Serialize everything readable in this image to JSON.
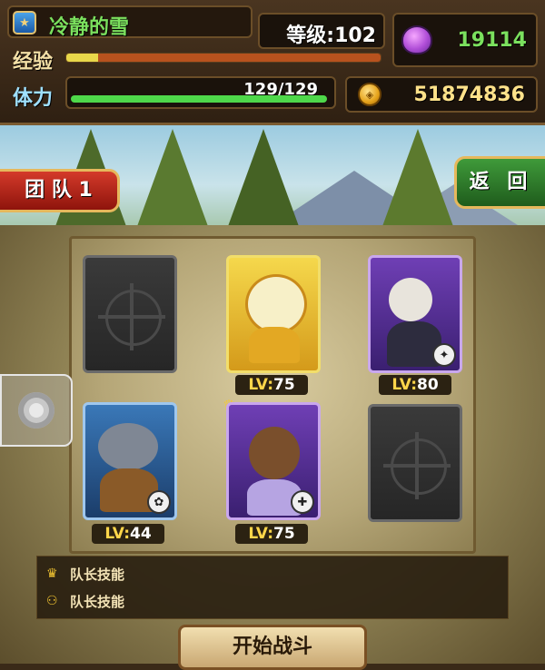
{
  "player": {
    "name": "冷静的雪",
    "level_label": "等级:",
    "level": "102",
    "exp_label": "经验",
    "exp_fraction": 0.1,
    "stamina_label": "体力",
    "stamina_text": "129/129",
    "stamina_fraction": 1.0
  },
  "currency": {
    "gems": "19114",
    "gold": "51874836"
  },
  "buttons": {
    "team": "团 队 1",
    "back": "返 回",
    "start": "开始战斗"
  },
  "slots": [
    {
      "type": "empty"
    },
    {
      "type": "hero",
      "level_prefix": "LV:",
      "level": "75",
      "style": "gold",
      "leader": false
    },
    {
      "type": "hero",
      "level_prefix": "LV:",
      "level": "80",
      "style": "purple",
      "leader": false
    },
    {
      "type": "hero",
      "level_prefix": "LV:",
      "level": "44",
      "style": "blue",
      "leader": false
    },
    {
      "type": "hero",
      "level_prefix": "LV:",
      "level": "75",
      "style": "purple",
      "leader": true
    },
    {
      "type": "empty"
    }
  ],
  "skills": [
    {
      "icon": "crown-icon",
      "label": "队长技能"
    },
    {
      "icon": "duo-icon",
      "label": "队长技能"
    }
  ],
  "colors": {
    "gem_green": "#7be05e",
    "gold_text": "#ffe28a",
    "team_red": "#d43a2a",
    "back_green": "#3f9a3a"
  }
}
